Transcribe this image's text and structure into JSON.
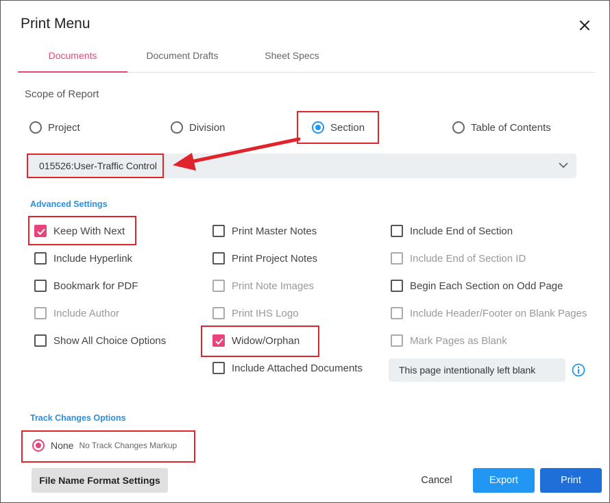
{
  "dialog": {
    "title": "Print Menu"
  },
  "tabs": [
    {
      "label": "Documents",
      "active": true
    },
    {
      "label": "Document Drafts",
      "active": false
    },
    {
      "label": "Sheet Specs",
      "active": false
    }
  ],
  "scope": {
    "label": "Scope of Report",
    "options": [
      {
        "label": "Project",
        "selected": false
      },
      {
        "label": "Division",
        "selected": false
      },
      {
        "label": "Section",
        "selected": true
      },
      {
        "label": "Table of Contents",
        "selected": false
      }
    ],
    "selected_section": "015526:User-Traffic Control"
  },
  "advanced": {
    "heading": "Advanced Settings",
    "col1": [
      {
        "label": "Keep With Next",
        "checked": true,
        "disabled": false
      },
      {
        "label": "Include Hyperlink",
        "checked": false,
        "disabled": false
      },
      {
        "label": "Bookmark for PDF",
        "checked": false,
        "disabled": false
      },
      {
        "label": "Include Author",
        "checked": false,
        "disabled": true
      },
      {
        "label": "Show All Choice Options",
        "checked": false,
        "disabled": false
      }
    ],
    "col2": [
      {
        "label": "Print Master Notes",
        "checked": false,
        "disabled": false
      },
      {
        "label": "Print Project Notes",
        "checked": false,
        "disabled": false
      },
      {
        "label": "Print Note Images",
        "checked": false,
        "disabled": true
      },
      {
        "label": "Print IHS Logo",
        "checked": false,
        "disabled": true
      },
      {
        "label": "Widow/Orphan",
        "checked": true,
        "disabled": false
      },
      {
        "label": "Include Attached Documents",
        "checked": false,
        "disabled": false
      }
    ],
    "col3": [
      {
        "label": "Include End of Section",
        "checked": false,
        "disabled": false
      },
      {
        "label": "Include End of Section ID",
        "checked": false,
        "disabled": true
      },
      {
        "label": "Begin Each Section on Odd Page",
        "checked": false,
        "disabled": false
      },
      {
        "label": "Include Header/Footer on Blank Pages",
        "checked": false,
        "disabled": true
      },
      {
        "label": "Mark Pages as Blank",
        "checked": false,
        "disabled": true
      }
    ],
    "blank_page_text": "This page intentionally left blank"
  },
  "track_changes": {
    "heading": "Track Changes Options",
    "option_label": "None",
    "option_sub": "No Track Changes Markup",
    "selected": true
  },
  "buttons": {
    "file_name": "File Name Format Settings",
    "cancel": "Cancel",
    "export": "Export",
    "print": "Print"
  },
  "colors": {
    "accent_pink": "#e8447a",
    "accent_blue": "#2196f3",
    "print_blue": "#1e6fd9",
    "annotation_red": "#e0242b"
  },
  "icons": [
    "close-icon",
    "chevron-down-icon",
    "check-icon",
    "info-icon"
  ]
}
